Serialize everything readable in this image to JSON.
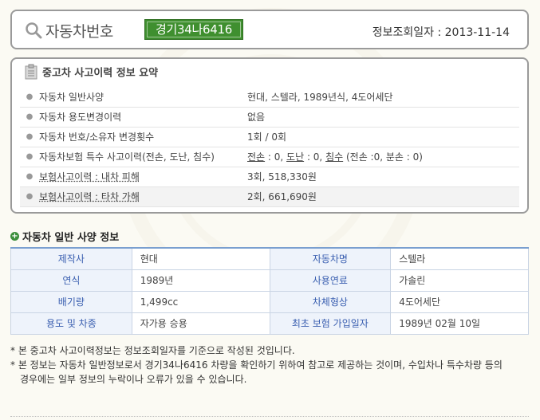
{
  "header": {
    "title": "자동차번호",
    "plate": "경기34나6416",
    "query_date": "정보조회일자 : 2013-11-14"
  },
  "summary": {
    "title": "중고차 사고이력 정보 요약",
    "rows": [
      {
        "key": "자동차 일반사양",
        "value": "현대, 스텔라, 1989년식, 4도어세단"
      },
      {
        "key": "자동차 용도변경이력",
        "value": "없음"
      },
      {
        "key": "자동차 번호/소유자 변경횟수",
        "value": "1회 / 0회"
      },
      {
        "key": "자동차보험 특수 사고이력(전손, 도난, 침수)",
        "value_parts": {
          "p1": "전손",
          "p2": " : 0, ",
          "p3": "도난",
          "p4": " : 0, ",
          "p5": "침수",
          "p6": " (전손 :0, 분손 : 0)"
        }
      },
      {
        "key": "보험사고이력 : 내차 피해",
        "value": "3회, 518,330원"
      },
      {
        "key": "보험사고이력 : 타차 가해",
        "value": "2회, 661,690원"
      }
    ]
  },
  "spec": {
    "title": "자동차 일반 사양 정보",
    "rows": [
      {
        "l1": "제작사",
        "v1": "현대",
        "l2": "자동차명",
        "v2": "스텔라"
      },
      {
        "l1": "연식",
        "v1": "1989년",
        "l2": "사용연료",
        "v2": "가솔린"
      },
      {
        "l1": "배기량",
        "v1": "1,499cc",
        "l2": "차체형상",
        "v2": "4도어세단"
      },
      {
        "l1": "용도 및 차종",
        "v1": "자가용 승용",
        "l2": "최초 보험 가입일자",
        "v2": "1989년 02월 10일"
      }
    ]
  },
  "notes": {
    "line1": "* 본 중고차 사고이력정보는 정보조회일자를 기준으로 작성된 것입니다.",
    "line2": "* 본 정보는 자동차 일반정보로서 경기34나6416 차량을 확인하기 위하여 참고로 제공하는 것이며, 수입차나 특수차량 등의",
    "line3": "경우에는 일부 정보의 누락이나 오류가 있을 수 있습니다."
  },
  "icons": {
    "search": "search-icon",
    "document": "document-icon",
    "bullet": "bullet-icon",
    "section": "plus-circle-icon"
  },
  "colors": {
    "plate_bg": "#3f8f2f",
    "table_header_text": "#3a5fb0",
    "table_header_bg": "#eef3fb",
    "section_icon": "#3c8f3c"
  }
}
